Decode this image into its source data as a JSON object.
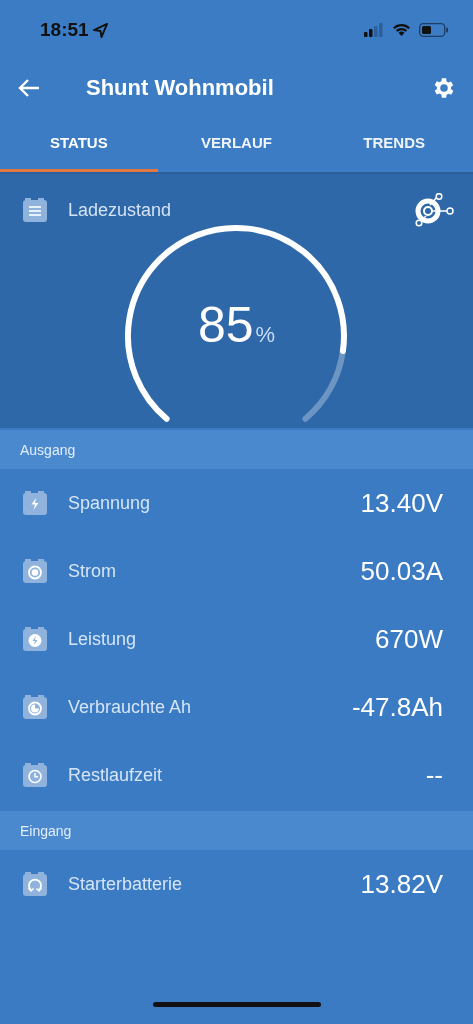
{
  "status_bar": {
    "time": "18:51"
  },
  "app_bar": {
    "title": "Shunt Wohnmobil"
  },
  "tabs": [
    {
      "label": "STATUS",
      "selected": true
    },
    {
      "label": "VERLAUF",
      "selected": false
    },
    {
      "label": "TRENDS",
      "selected": false
    }
  ],
  "gauge": {
    "title": "Ladezustand",
    "value": "85",
    "unit": "%"
  },
  "sections": [
    {
      "title": "Ausgang",
      "rows": [
        {
          "kind": "voltage",
          "label": "Spannung",
          "value": "13.40V"
        },
        {
          "kind": "current",
          "label": "Strom",
          "value": "50.03A"
        },
        {
          "kind": "power",
          "label": "Leistung",
          "value": "670W"
        },
        {
          "kind": "consumed",
          "label": "Verbrauchte Ah",
          "value": "-47.8Ah"
        },
        {
          "kind": "time",
          "label": "Restlaufzeit",
          "value": "--"
        }
      ]
    },
    {
      "title": "Eingang",
      "rows": [
        {
          "kind": "starter",
          "label": "Starterbatterie",
          "value": "13.82V"
        }
      ]
    }
  ]
}
